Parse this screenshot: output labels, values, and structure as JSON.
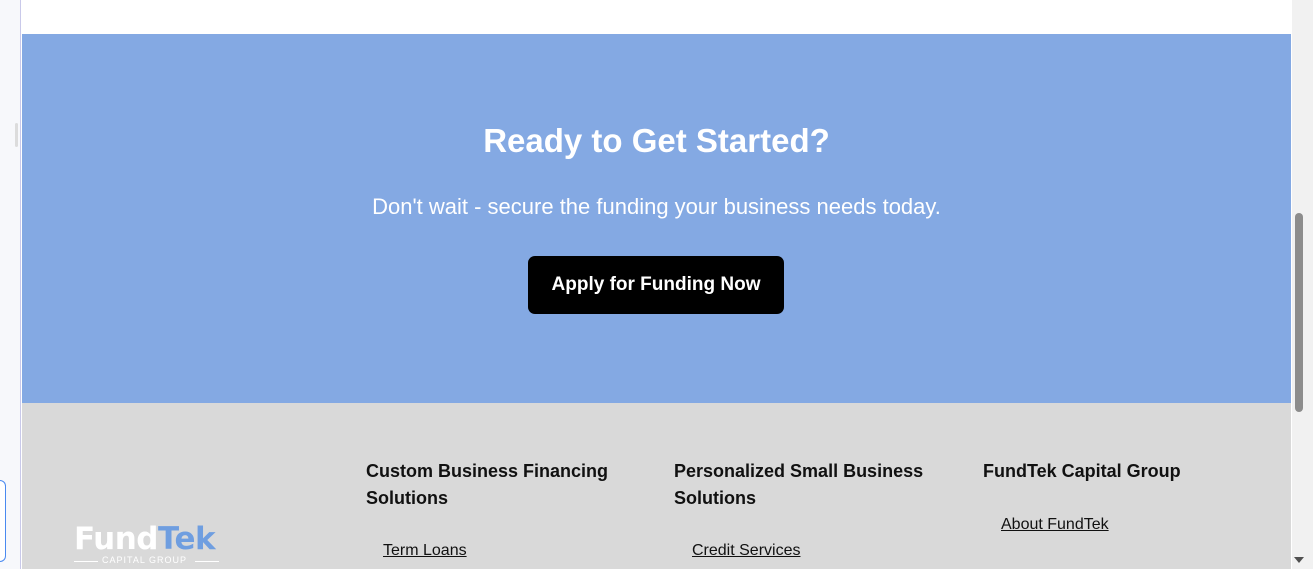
{
  "cta": {
    "title": "Ready to Get Started?",
    "subtitle": "Don't wait - secure the funding your business needs today.",
    "button_label": "Apply for Funding Now"
  },
  "footer": {
    "logo": {
      "fund": "Fund",
      "tek": "Tek",
      "tagline": "CAPITAL GROUP"
    },
    "columns": [
      {
        "heading": "Custom Business Financing Solutions",
        "links": [
          "Term Loans"
        ]
      },
      {
        "heading": "Personalized Small Business Solutions",
        "links": [
          "Credit Services"
        ]
      },
      {
        "heading": "FundTek Capital Group",
        "links": [
          "About FundTek"
        ]
      }
    ]
  },
  "colors": {
    "cta_background": "#84a9e3",
    "footer_background": "#d9d9d9",
    "button_background": "#000000",
    "logo_accent": "#6f9ee0"
  },
  "icons": [
    "scroll-down-arrow-icon"
  ]
}
